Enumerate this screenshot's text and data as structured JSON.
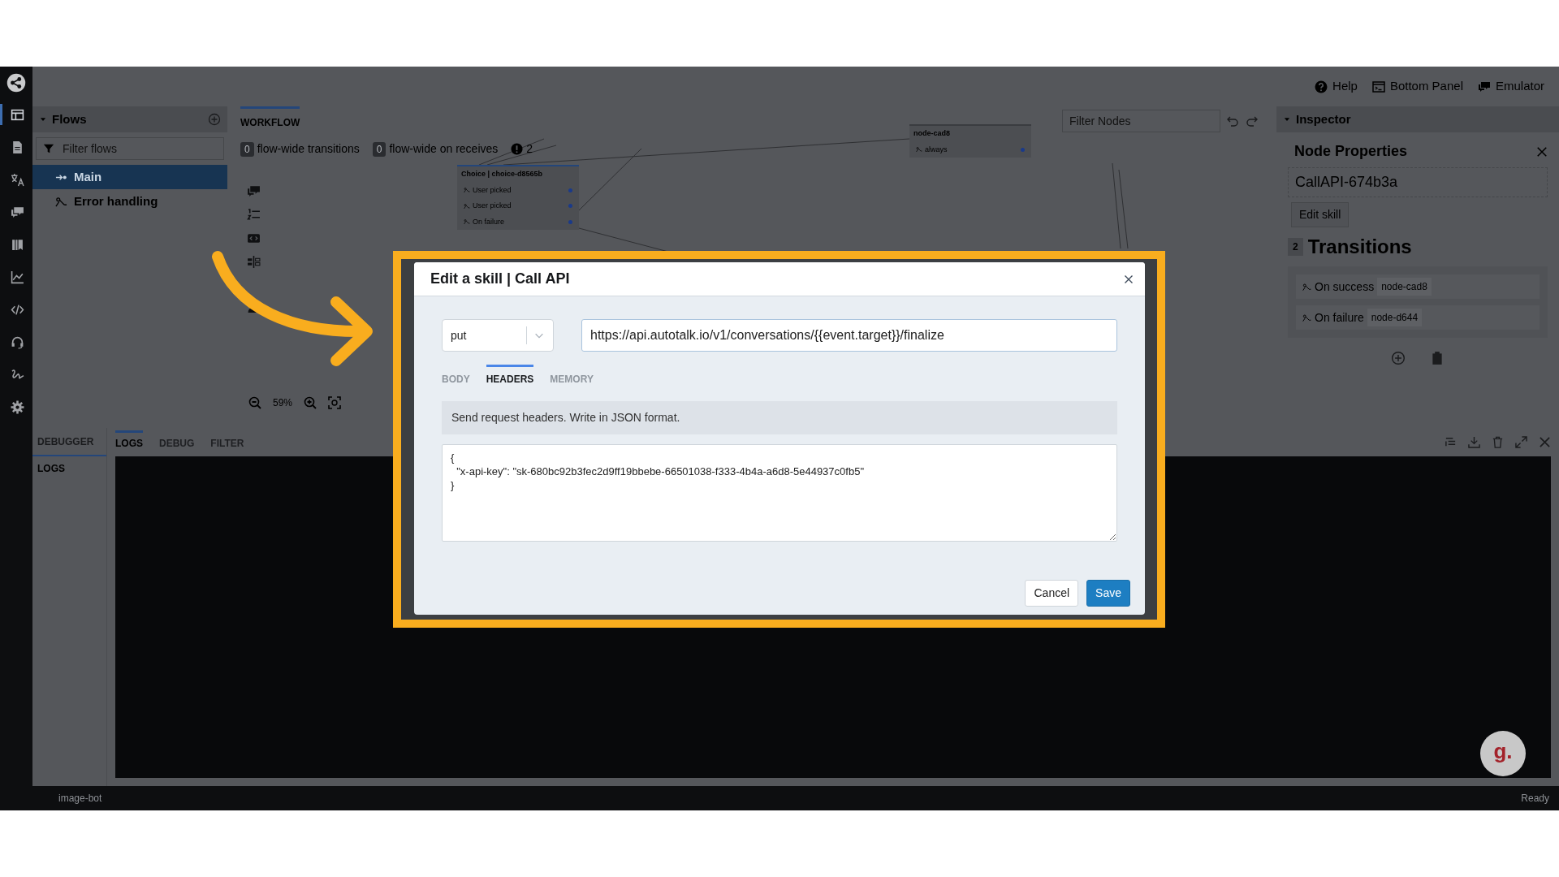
{
  "nav_items": [
    {
      "selected": true
    },
    {
      "selected": false
    },
    {
      "selected": false
    },
    {
      "selected": false
    },
    {
      "selected": false
    },
    {
      "selected": false
    },
    {
      "selected": false
    },
    {
      "selected": false
    },
    {
      "selected": false
    },
    {
      "selected": false
    }
  ],
  "top_bar": {
    "buttons": [
      "Help",
      "Bottom Panel",
      "Emulator"
    ]
  },
  "flows": {
    "title": "Flows",
    "filter_placeholder": "Filter flows",
    "items": [
      {
        "label": "Main",
        "selected": true
      },
      {
        "label": "Error handling",
        "selected": false
      }
    ]
  },
  "workflow": {
    "tab": "WORKFLOW",
    "filter_placeholder": "Filter Nodes",
    "counters": [
      {
        "count": "0",
        "label": "flow-wide transitions"
      },
      {
        "count": "0",
        "label": "flow-wide on receives"
      }
    ],
    "warnings": "2",
    "zoom": "59%",
    "nodes": [
      {
        "title": "Choice | choice-d8565b",
        "rows": [
          "User picked",
          "User picked",
          "On failure"
        ]
      },
      {
        "title": "node-cad8",
        "rows": [
          "always"
        ]
      }
    ]
  },
  "inspector": {
    "title": "Inspector",
    "heading": "Node Properties",
    "node_name": "CallAPI-674b3a",
    "edit_button": "Edit skill",
    "transitions_count": "2",
    "transitions_title": "Transitions",
    "transitions": [
      {
        "label": "On success",
        "target": "node-cad8"
      },
      {
        "label": "On failure",
        "target": "node-d644"
      }
    ]
  },
  "bottom_panel": {
    "side_title": "DEBUGGER",
    "side_item": "LOGS",
    "tabs": [
      {
        "label": "LOGS",
        "selected": true
      },
      {
        "label": "DEBUG",
        "selected": false
      },
      {
        "label": "FILTER",
        "selected": false
      }
    ]
  },
  "status_bar": {
    "bot": "image-bot",
    "status": "Ready"
  },
  "modal": {
    "title": "Edit a skill | Call API",
    "method": "put",
    "url": "https://api.autotalk.io/v1/conversations/{{event.target}}/finalize",
    "tabs": [
      {
        "label": "BODY",
        "selected": false
      },
      {
        "label": "HEADERS",
        "selected": true
      },
      {
        "label": "MEMORY",
        "selected": false
      }
    ],
    "hint": "Send request headers. Write in JSON format.",
    "headers_json": "{\n  \"x-api-key\": \"sk-680bc92b3fec2d9ff19bbebe-66501038-f333-4b4a-a6d8-5e44937c0fb5\"\n}",
    "buttons": [
      {
        "label": "Cancel",
        "kind": "secondary"
      },
      {
        "label": "Save",
        "kind": "primary"
      }
    ]
  },
  "help_badge": "g."
}
